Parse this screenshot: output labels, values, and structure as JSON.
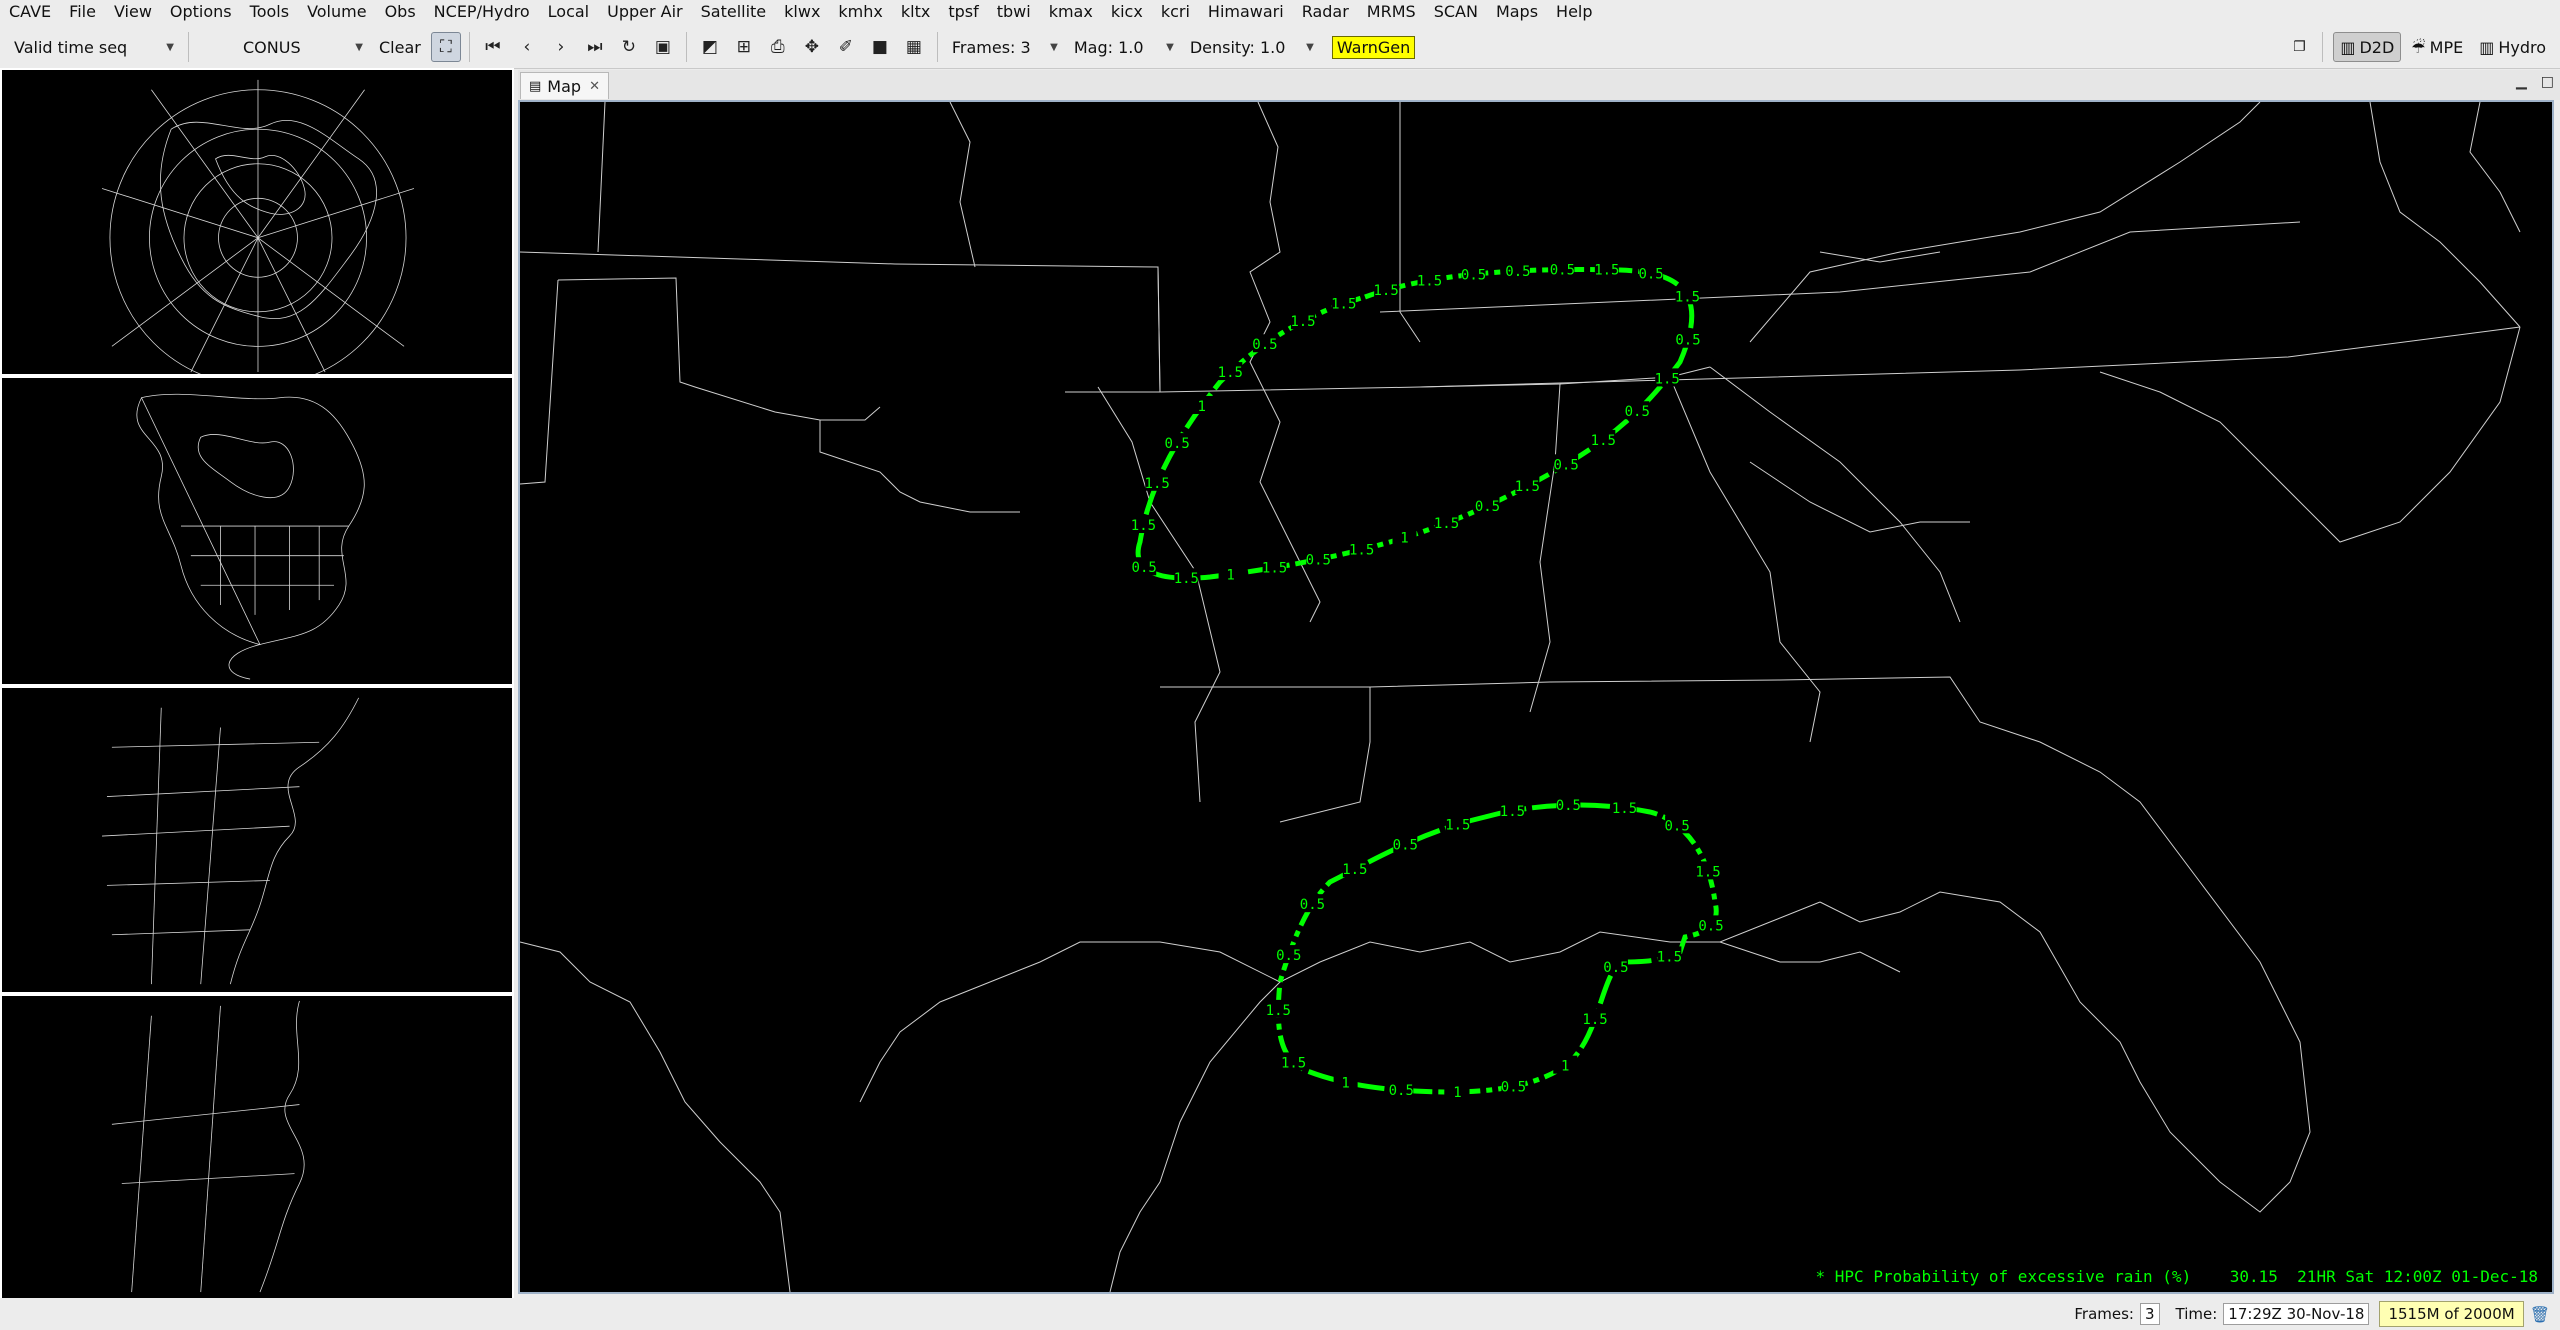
{
  "menu": [
    "CAVE",
    "File",
    "View",
    "Options",
    "Tools",
    "Volume",
    "Obs",
    "NCEP/Hydro",
    "Local",
    "Upper Air",
    "Satellite",
    "klwx",
    "kmhx",
    "kltx",
    "tpsf",
    "tbwi",
    "kmax",
    "kicx",
    "kcri",
    "Himawari",
    "Radar",
    "MRMS",
    "SCAN",
    "Maps",
    "Help"
  ],
  "toolbar": {
    "time_mode": "Valid time seq",
    "scale": "CONUS",
    "clear_label": "Clear",
    "frames_label": "Frames: 3",
    "mag_label": "Mag: 1.0",
    "density_label": "Density: 1.0",
    "warngen_label": "WarnGen"
  },
  "perspectives": [
    {
      "label": "D2D",
      "active": true
    },
    {
      "label": "MPE",
      "active": false
    },
    {
      "label": "Hydro",
      "active": false
    }
  ],
  "editor": {
    "tab_label": "Map"
  },
  "legend": {
    "product": "* HPC Probability of excessive rain (%)",
    "value": "30.15",
    "valid": "21HR Sat 12:00Z 01-Dec-18"
  },
  "contours": {
    "color": "#00ff00",
    "north_labels": [
      "1.5",
      "1.5",
      "0.5",
      "0.5",
      "0.5",
      "1.5",
      "0.5",
      "1.5",
      "0.5",
      "1.5",
      "0.5",
      "1.5",
      "0.5",
      "1.5",
      "0.5",
      "1.5",
      "1",
      "1.5",
      "0.5",
      "1.5",
      "1",
      "1.5",
      "0.5",
      "1.5",
      "1.5",
      "0.5",
      "1",
      "1.5",
      "0.5",
      "1.5",
      "1.5"
    ],
    "south_labels": [
      "1.5",
      "0.5",
      "1.5",
      "0.5",
      "1.5",
      "0.5",
      "1.5",
      "0.5",
      "1.5",
      "1",
      "0.5",
      "1",
      "0.5",
      "1",
      "1.5",
      "1.5",
      "0.5",
      "0.5",
      "1.5",
      "0.5",
      "1.5"
    ]
  },
  "status": {
    "frames_label": "Frames:",
    "frames_value": "3",
    "time_label": "Time:",
    "time_value": "17:29Z 30-Nov-18",
    "memory": "1515M of 2000M"
  }
}
